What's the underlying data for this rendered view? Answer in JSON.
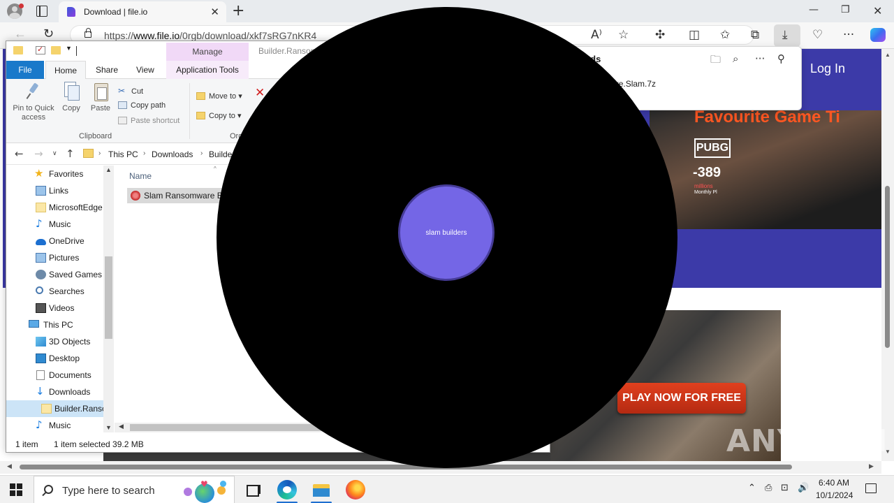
{
  "browser": {
    "tab_title": "Download | file.io",
    "tab_close": "✕",
    "new_tab": "+",
    "win_min": "—",
    "win_max": "❐",
    "win_close": "✕",
    "url_prefix": "https://",
    "url_host": "www.file.io",
    "url_path": "/0rgb/download/xkf7sRG7nKR4",
    "icons": [
      "read-aloud-icon",
      "favorite-star-icon",
      "extensions-icon",
      "split-screen-icon",
      "favorites-icon",
      "collections-icon",
      "downloads-icon",
      "browser-essentials-icon",
      "more-icon",
      "copilot-icon"
    ]
  },
  "downloads_panel": {
    "title": "Downloads",
    "file": "Slam Ransomware.Slam.7z"
  },
  "webpage": {
    "login": "Log In",
    "banner_title": "Favourite Game",
    "banner_title_accent": "Ti",
    "pubg": "PUBG",
    "price": "-389",
    "price_sub": "millions",
    "price_sub2": "Monthly Pl",
    "cta": "PLAY NOW FOR FREE",
    "watermark": "ANY RUN"
  },
  "explorer": {
    "manage": "Manage",
    "title": "Builder.Ransomware.Slam",
    "tabs": {
      "file": "File",
      "home": "Home",
      "share": "Share",
      "view": "View",
      "app_tools": "Application Tools"
    },
    "ribbon": {
      "pin_line1": "Pin to Quick",
      "pin_line2": "access",
      "copy": "Copy",
      "paste": "Paste",
      "cut": "Cut",
      "copy_path": "Copy path",
      "paste_shortcut": "Paste shortcut",
      "clipboard": "Clipboard",
      "move_to": "Move to",
      "copy_to": "Copy to",
      "organize": "Organize"
    },
    "breadcrumb": [
      "This PC",
      "Downloads",
      "Builder.Ransomware.Slam"
    ],
    "nav": [
      "Favorites",
      "Links",
      "MicrosoftEdge",
      "Music",
      "OneDrive",
      "Pictures",
      "Saved Games",
      "Searches",
      "Videos",
      "This PC",
      "3D Objects",
      "Desktop",
      "Documents",
      "Downloads",
      "Builder.Ransomware.Slam",
      "Music"
    ],
    "column_name": "Name",
    "file_name": "Slam Ransomware Builder.exe",
    "status_count": "1 item",
    "status_selected": "1 item selected  39.2 MB"
  },
  "overlay": {
    "label": "slam builders",
    "colors": {
      "outer": "#000000",
      "inner": "#7466e6",
      "inner_border": "#463c98"
    }
  },
  "taskbar": {
    "search_placeholder": "Type here to search",
    "time": "6:40 AM",
    "date": "10/1/2024",
    "tray_icons": [
      "chevron-up-icon",
      "meet-now-icon",
      "network-icon",
      "volume-icon"
    ]
  }
}
